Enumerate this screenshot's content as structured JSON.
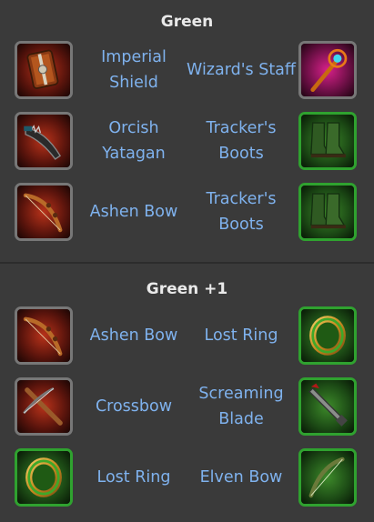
{
  "sections": [
    {
      "title": "Green",
      "rows": [
        {
          "left": {
            "name": "Imperial Shield",
            "icon": "imperial-shield-icon"
          },
          "right": {
            "name": "Wizard's Staff",
            "icon": "wizards-staff-icon"
          }
        },
        {
          "left": {
            "name": "Orcish Yatagan",
            "icon": "orcish-yatagan-icon"
          },
          "right": {
            "name": "Tracker's Boots",
            "icon": "trackers-boots-icon"
          }
        },
        {
          "left": {
            "name": "Ashen Bow",
            "icon": "ashen-bow-icon"
          },
          "right": {
            "name": "Tracker's Boots",
            "icon": "trackers-boots-icon"
          }
        }
      ]
    },
    {
      "title": "Green +1",
      "rows": [
        {
          "left": {
            "name": "Ashen Bow",
            "icon": "ashen-bow-icon"
          },
          "right": {
            "name": "Lost Ring",
            "icon": "lost-ring-icon"
          }
        },
        {
          "left": {
            "name": "Crossbow",
            "icon": "crossbow-icon"
          },
          "right": {
            "name": "Screaming Blade",
            "icon": "screaming-blade-icon"
          }
        },
        {
          "left": {
            "name": "Lost Ring",
            "icon": "lost-ring-icon"
          },
          "right": {
            "name": "Elven Bow",
            "icon": "elven-bow-icon"
          }
        }
      ]
    }
  ],
  "colors": {
    "background": "#3a3a3a",
    "title": "#e9e9e9",
    "item_name": "#7fb2ee",
    "green_frame": "#2fa22f",
    "grey_frame": "#777777"
  }
}
